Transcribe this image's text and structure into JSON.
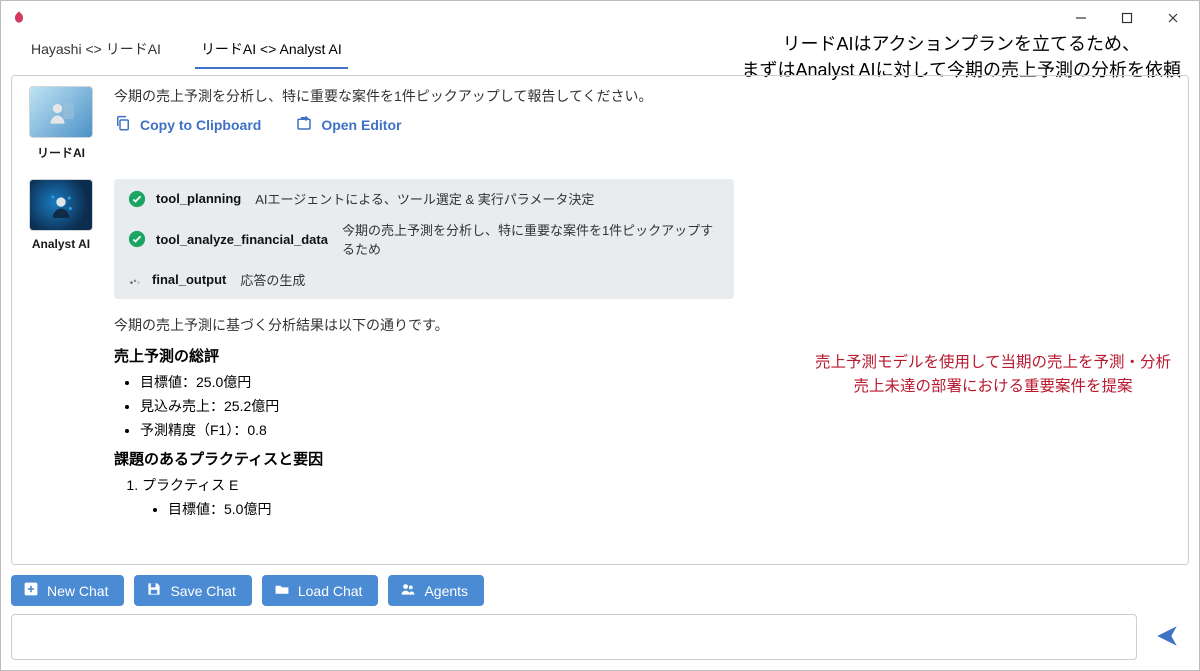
{
  "annotations": {
    "top_line1": "リードAIはアクションプランを立てるため、",
    "top_line2": "まずはAnalyst AIに対して今期の売上予測の分析を依頼",
    "right_line1": "売上予測モデルを使用して当期の売上を予測・分析",
    "right_line2": "売上未達の部署における重要案件を提案"
  },
  "tabs": {
    "t0": "Hayashi <> リードAI",
    "t1": "リードAI <> Analyst AI"
  },
  "lead": {
    "name": "リードAI",
    "prompt": "今期の売上予測を分析し、特に重要な案件を1件ピックアップして報告してください。",
    "toolbar": {
      "copy": "Copy to Clipboard",
      "open": "Open Editor"
    }
  },
  "analyst": {
    "name": "Analyst AI",
    "steps": {
      "s0": {
        "name": "tool_planning",
        "desc": "AIエージェントによる、ツール選定 & 実行パラメータ決定"
      },
      "s1": {
        "name": "tool_analyze_financial_data",
        "desc": "今期の売上予測を分析し、特に重要な案件を1件ピックアップするため"
      },
      "s2": {
        "name": "final_output",
        "desc": "応答の生成"
      }
    },
    "analysis": {
      "intro": "今期の売上予測に基づく分析結果は以下の通りです。",
      "h1": "売上予測の総評",
      "li1": "目標値：25.0億円",
      "li2": "見込み売上：25.2億円",
      "li3": "予測精度（F1）：0.8",
      "h2": "課題のあるプラクティスと要因",
      "ol1": "プラクティス E",
      "sub1": "目標値：5.0億円"
    }
  },
  "buttons": {
    "new": "New Chat",
    "save": "Save Chat",
    "load": "Load Chat",
    "agents": "Agents"
  },
  "input": {
    "placeholder": ""
  }
}
